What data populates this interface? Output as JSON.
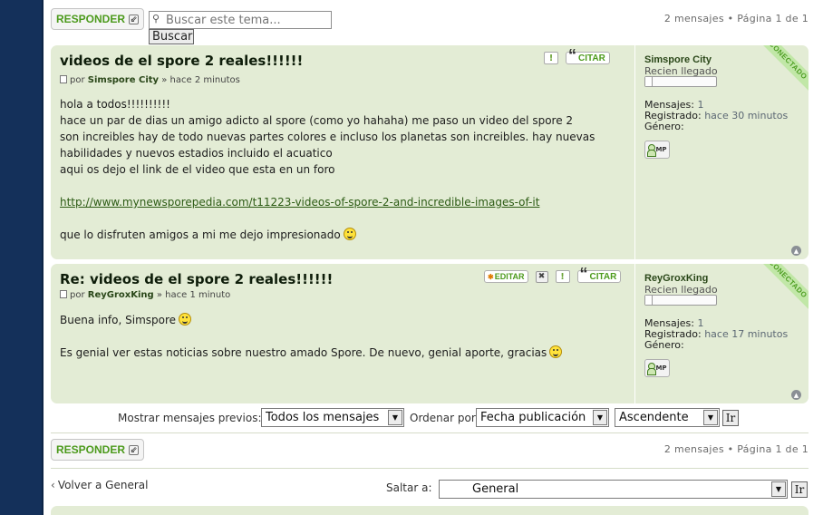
{
  "top_bar": {
    "reply_label": "RESPONDER",
    "search_placeholder": "Buscar este tema...",
    "search_button": "Buscar",
    "pagination": "2 mensajes • Página 1 de 1"
  },
  "posts": [
    {
      "title": "videos de el spore 2 reales!!!!!!",
      "author_prefix": "por",
      "author": "Simspore City",
      "time": "» hace 2 minutos",
      "lines": [
        "hola a todos!!!!!!!!!!",
        "hace un par de dias un amigo adicto al spore (como yo hahaha) me paso un video del spore 2",
        "son increibles hay de todo nuevas partes colores e incluso los planetas son increibles. hay nuevas",
        "habilidades y nuevos estadios incluido el acuatico",
        "aqui os dejo el link de el video que esta en un foro"
      ],
      "link": "http://www.mynewsporepedia.com/t11223-videos-of-spore-2-and-incredible-images-of-it",
      "closing": "que lo disfruten amigos a mi me dejo impresionado",
      "quote_label": "CITAR",
      "profile": {
        "name": "Simspore City",
        "rank": "Recien llegado",
        "rank_fill": 0.1,
        "messages_label": "Mensajes:",
        "messages": "1",
        "registered_label": "Registrado:",
        "registered": "hace 30 minutos",
        "gender_label": "Género:",
        "pm_label": "MP",
        "status": "CONECTADO"
      }
    },
    {
      "title": "Re: videos de el spore 2 reales!!!!!!",
      "author_prefix": "por",
      "author": "ReyGroxKing",
      "time": "» hace 1 minuto",
      "lines": [
        "Buena info, Simspore",
        "",
        "Es genial ver estas noticias sobre nuestro amado Spore. De nuevo, genial aporte, gracias"
      ],
      "edit_label": "EDITAR",
      "quote_label": "CITAR",
      "profile": {
        "name": "ReyGroxKing",
        "rank": "Recien llegado",
        "rank_fill": 0.1,
        "messages_label": "Mensajes:",
        "messages": "1",
        "registered_label": "Registrado:",
        "registered": "hace 17 minutos",
        "gender_label": "Género:",
        "pm_label": "MP",
        "status": "CONECTADO"
      }
    }
  ],
  "sort_bar": {
    "show_label": "Mostrar mensajes previos:",
    "show_value": "Todos los mensajes",
    "order_label": "Ordenar por",
    "order_value": "Fecha publicación",
    "direction_value": "Ascendente",
    "go_label": "Ir"
  },
  "bottom_bar": {
    "reply_label": "RESPONDER",
    "pagination": "2 mensajes • Página 1 de 1",
    "back_label": "Volver a General",
    "jump_label": "Saltar a:",
    "jump_value": "General",
    "go_label": "Ir"
  },
  "colors": {
    "accent": "#4c9a1c",
    "post_bg": "#e3ecd5",
    "page_bg": "#14305a"
  }
}
